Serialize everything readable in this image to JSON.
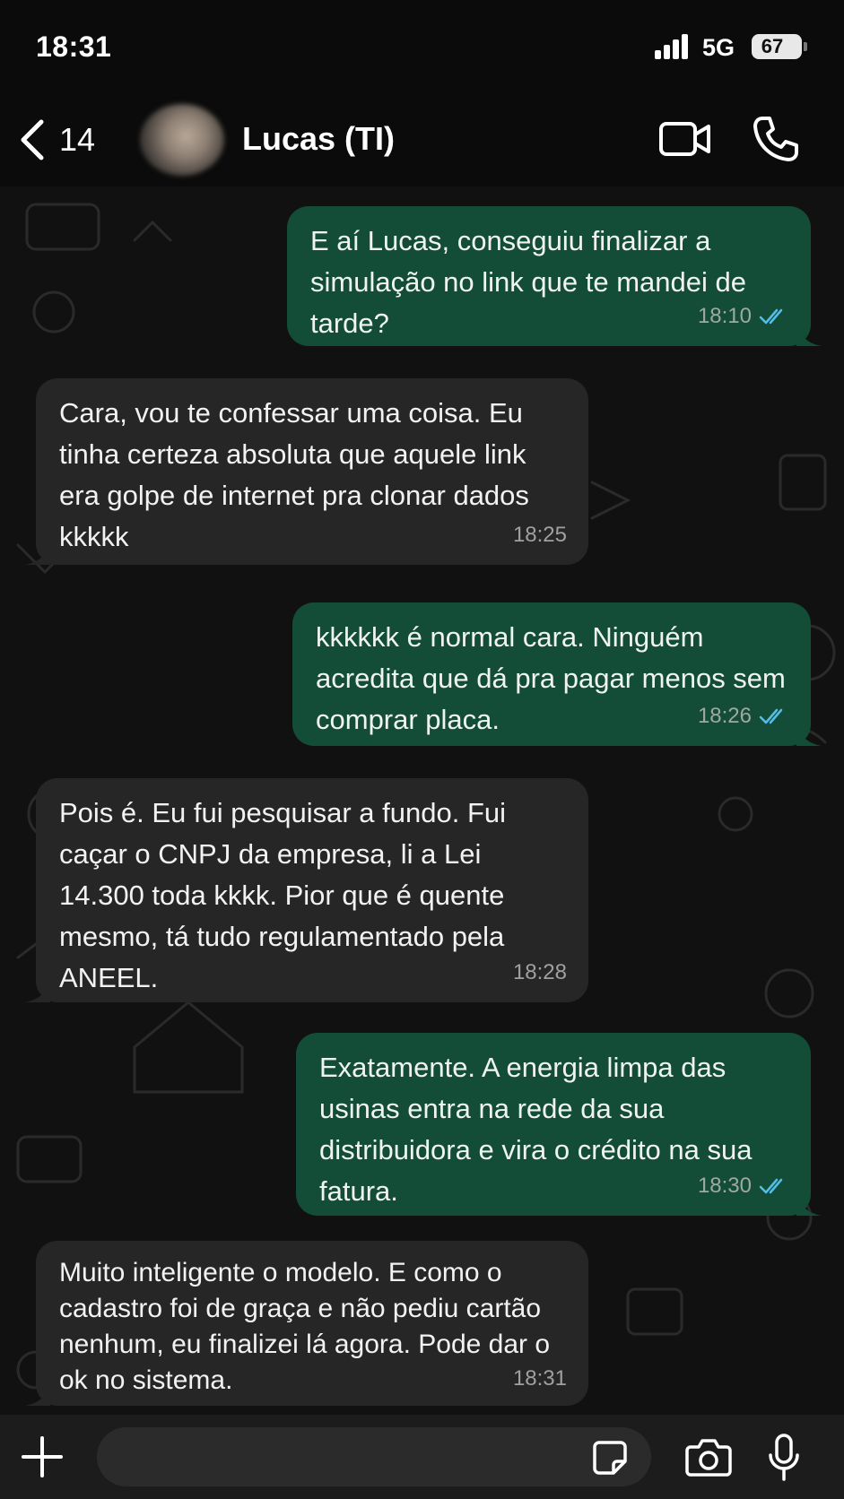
{
  "status_bar": {
    "time": "18:31",
    "network": "5G",
    "battery": "67"
  },
  "header": {
    "back_count": "14",
    "contact_name": "Lucas (TI)"
  },
  "messages": [
    {
      "direction": "out",
      "text": "E aí Lucas, conseguiu finalizar a simulação no link que te mandei de tarde?",
      "time": "18:10",
      "read": true
    },
    {
      "direction": "in",
      "text": "Cara, vou te confessar uma coisa. Eu tinha certeza absoluta que aquele link era golpe de internet pra clonar dados kkkkk",
      "time": "18:25"
    },
    {
      "direction": "out",
      "text": "kkkkkk é normal cara. Ninguém acredita que dá pra pagar menos sem comprar placa.",
      "time": "18:26",
      "read": true
    },
    {
      "direction": "in",
      "text": "Pois é. Eu fui pesquisar a fundo. Fui caçar o CNPJ da empresa, li a Lei 14.300 toda kkkk. Pior que é quente mesmo, tá tudo regulamentado pela ANEEL.",
      "time": "18:28"
    },
    {
      "direction": "out",
      "text": "Exatamente. A energia limpa das usinas entra na rede da sua distribuidora e vira o crédito na sua fatura.",
      "time": "18:30",
      "read": true
    },
    {
      "direction": "in",
      "text": "Muito inteligente o modelo. E como o cadastro foi de graça e não pediu cartão nenhum, eu finalizei lá agora. Pode dar o ok no sistema.",
      "time": "18:31"
    }
  ],
  "input": {
    "value": "",
    "placeholder": ""
  },
  "colors": {
    "outgoing_bubble": "#144d37",
    "incoming_bubble": "#262626",
    "read_ticks": "#53bdeb",
    "chat_background": "#111111"
  },
  "icons": {
    "back": "chevron-left-icon",
    "video": "video-camera-icon",
    "phone": "phone-icon",
    "attach": "plus-icon",
    "sticker": "sticker-icon",
    "camera": "camera-icon",
    "mic": "microphone-icon",
    "read": "double-check-icon"
  }
}
